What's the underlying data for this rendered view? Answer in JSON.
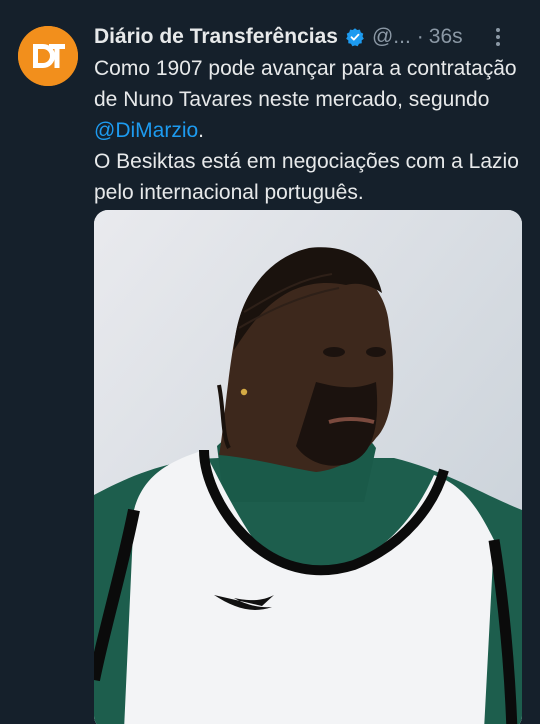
{
  "account": {
    "display_name": "Diário de Transferências",
    "handle": "@...",
    "separator": "·",
    "time": "36s",
    "avatar_text": "DT",
    "avatar_color": "#f28f1c",
    "verified_color": "#1d9bf0"
  },
  "tweet": {
    "line1": "Como 1907 pode avançar para a contratação de Nuno Tavares neste mercado, segundo ",
    "mention": "@DiMarzio",
    "line1_end": ".",
    "line2": "O Besiktas está em negociações com a Lazio pelo internacional português."
  },
  "media": {
    "description_icon": "photo-icon",
    "shirt_color": "#1d5e4d",
    "bib_color": "#f3f4f6"
  },
  "colors": {
    "background": "#15202b",
    "text": "#e7e9ea",
    "muted": "#8b98a5",
    "link": "#1d9bf0"
  }
}
